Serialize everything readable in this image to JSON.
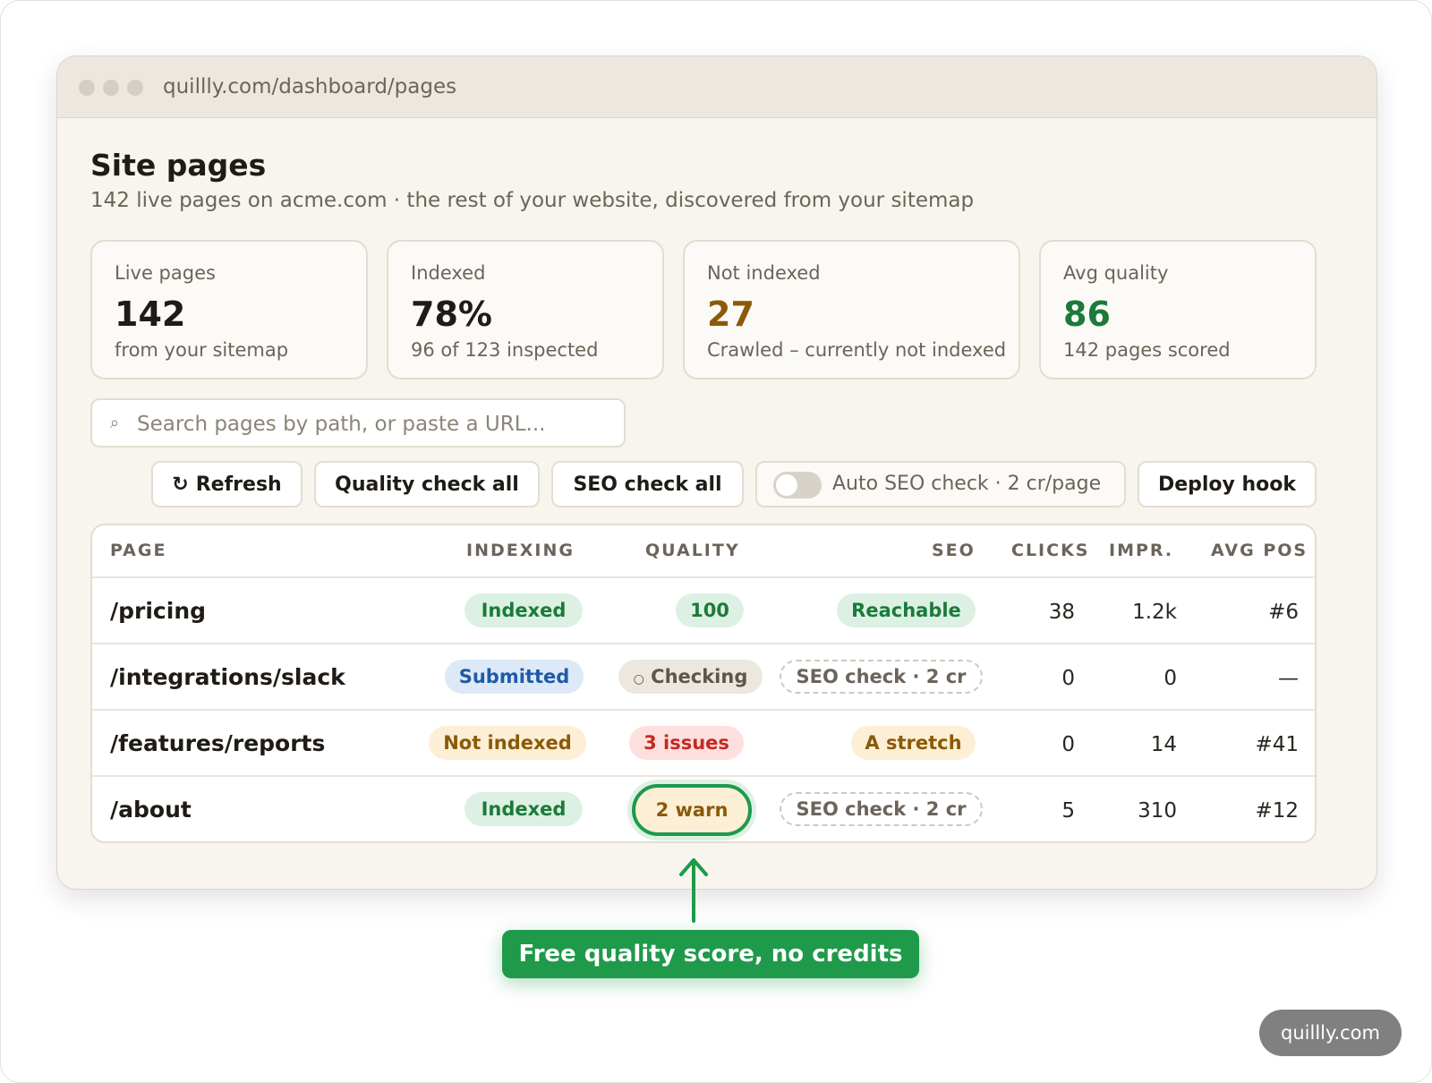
{
  "browser": {
    "url": "quillly.com/dashboard/pages"
  },
  "header": {
    "title": "Site pages",
    "subtitle": "142 live pages on acme.com · the rest of your website, discovered from your sitemap"
  },
  "stats": [
    {
      "label": "Live pages",
      "value": "142",
      "note": "from your sitemap",
      "color": "#1f1b16"
    },
    {
      "label": "Indexed",
      "value": "78%",
      "note": "96 of 123 inspected",
      "color": "#1f1b16"
    },
    {
      "label": "Not indexed",
      "value": "27",
      "note": "Crawled – currently not indexed",
      "color": "#8a5a08"
    },
    {
      "label": "Avg quality",
      "value": "86",
      "note": "142 pages scored",
      "color": "#1c7a3a"
    }
  ],
  "search": {
    "placeholder": "Search pages by path, or paste a URL...",
    "icon": "search-icon"
  },
  "toolbar": {
    "refresh_icon": "↻",
    "refresh_label": "Refresh",
    "quality_all_label": "Quality check all",
    "seo_all_label": "SEO check all",
    "auto_seo_label": "Auto SEO check · 2 cr/page",
    "auto_seo_on": false,
    "deploy_label": "Deploy hook"
  },
  "table": {
    "columns": {
      "page": "PAGE",
      "indexing": "INDEXING",
      "quality": "QUALITY",
      "seo": "SEO",
      "clicks": "CLICKS",
      "impr": "IMPR.",
      "avgpos": "AVG POS"
    },
    "rows": [
      {
        "path": "/pricing",
        "indexing": "Indexed",
        "quality": "100",
        "seo": "Reachable",
        "clicks": "38",
        "impr": "1.2k",
        "avgpos": "#6"
      },
      {
        "path": "/integrations/slack",
        "indexing": "Submitted",
        "quality": "Checking",
        "quality_icon": "○",
        "seo": "SEO check · 2 cr",
        "clicks": "0",
        "impr": "0",
        "avgpos": "—"
      },
      {
        "path": "/features/reports",
        "indexing": "Not indexed",
        "quality": "3 issues",
        "seo": "A stretch",
        "clicks": "0",
        "impr": "14",
        "avgpos": "#41"
      },
      {
        "path": "/about",
        "indexing": "Indexed",
        "quality": "2 warn",
        "seo": "SEO check · 2 cr",
        "clicks": "5",
        "impr": "310",
        "avgpos": "#12"
      }
    ]
  },
  "callout": {
    "text": "Free quality score, no credits",
    "color": "#1e9a4a"
  },
  "brand": {
    "text": "quillly.com"
  }
}
